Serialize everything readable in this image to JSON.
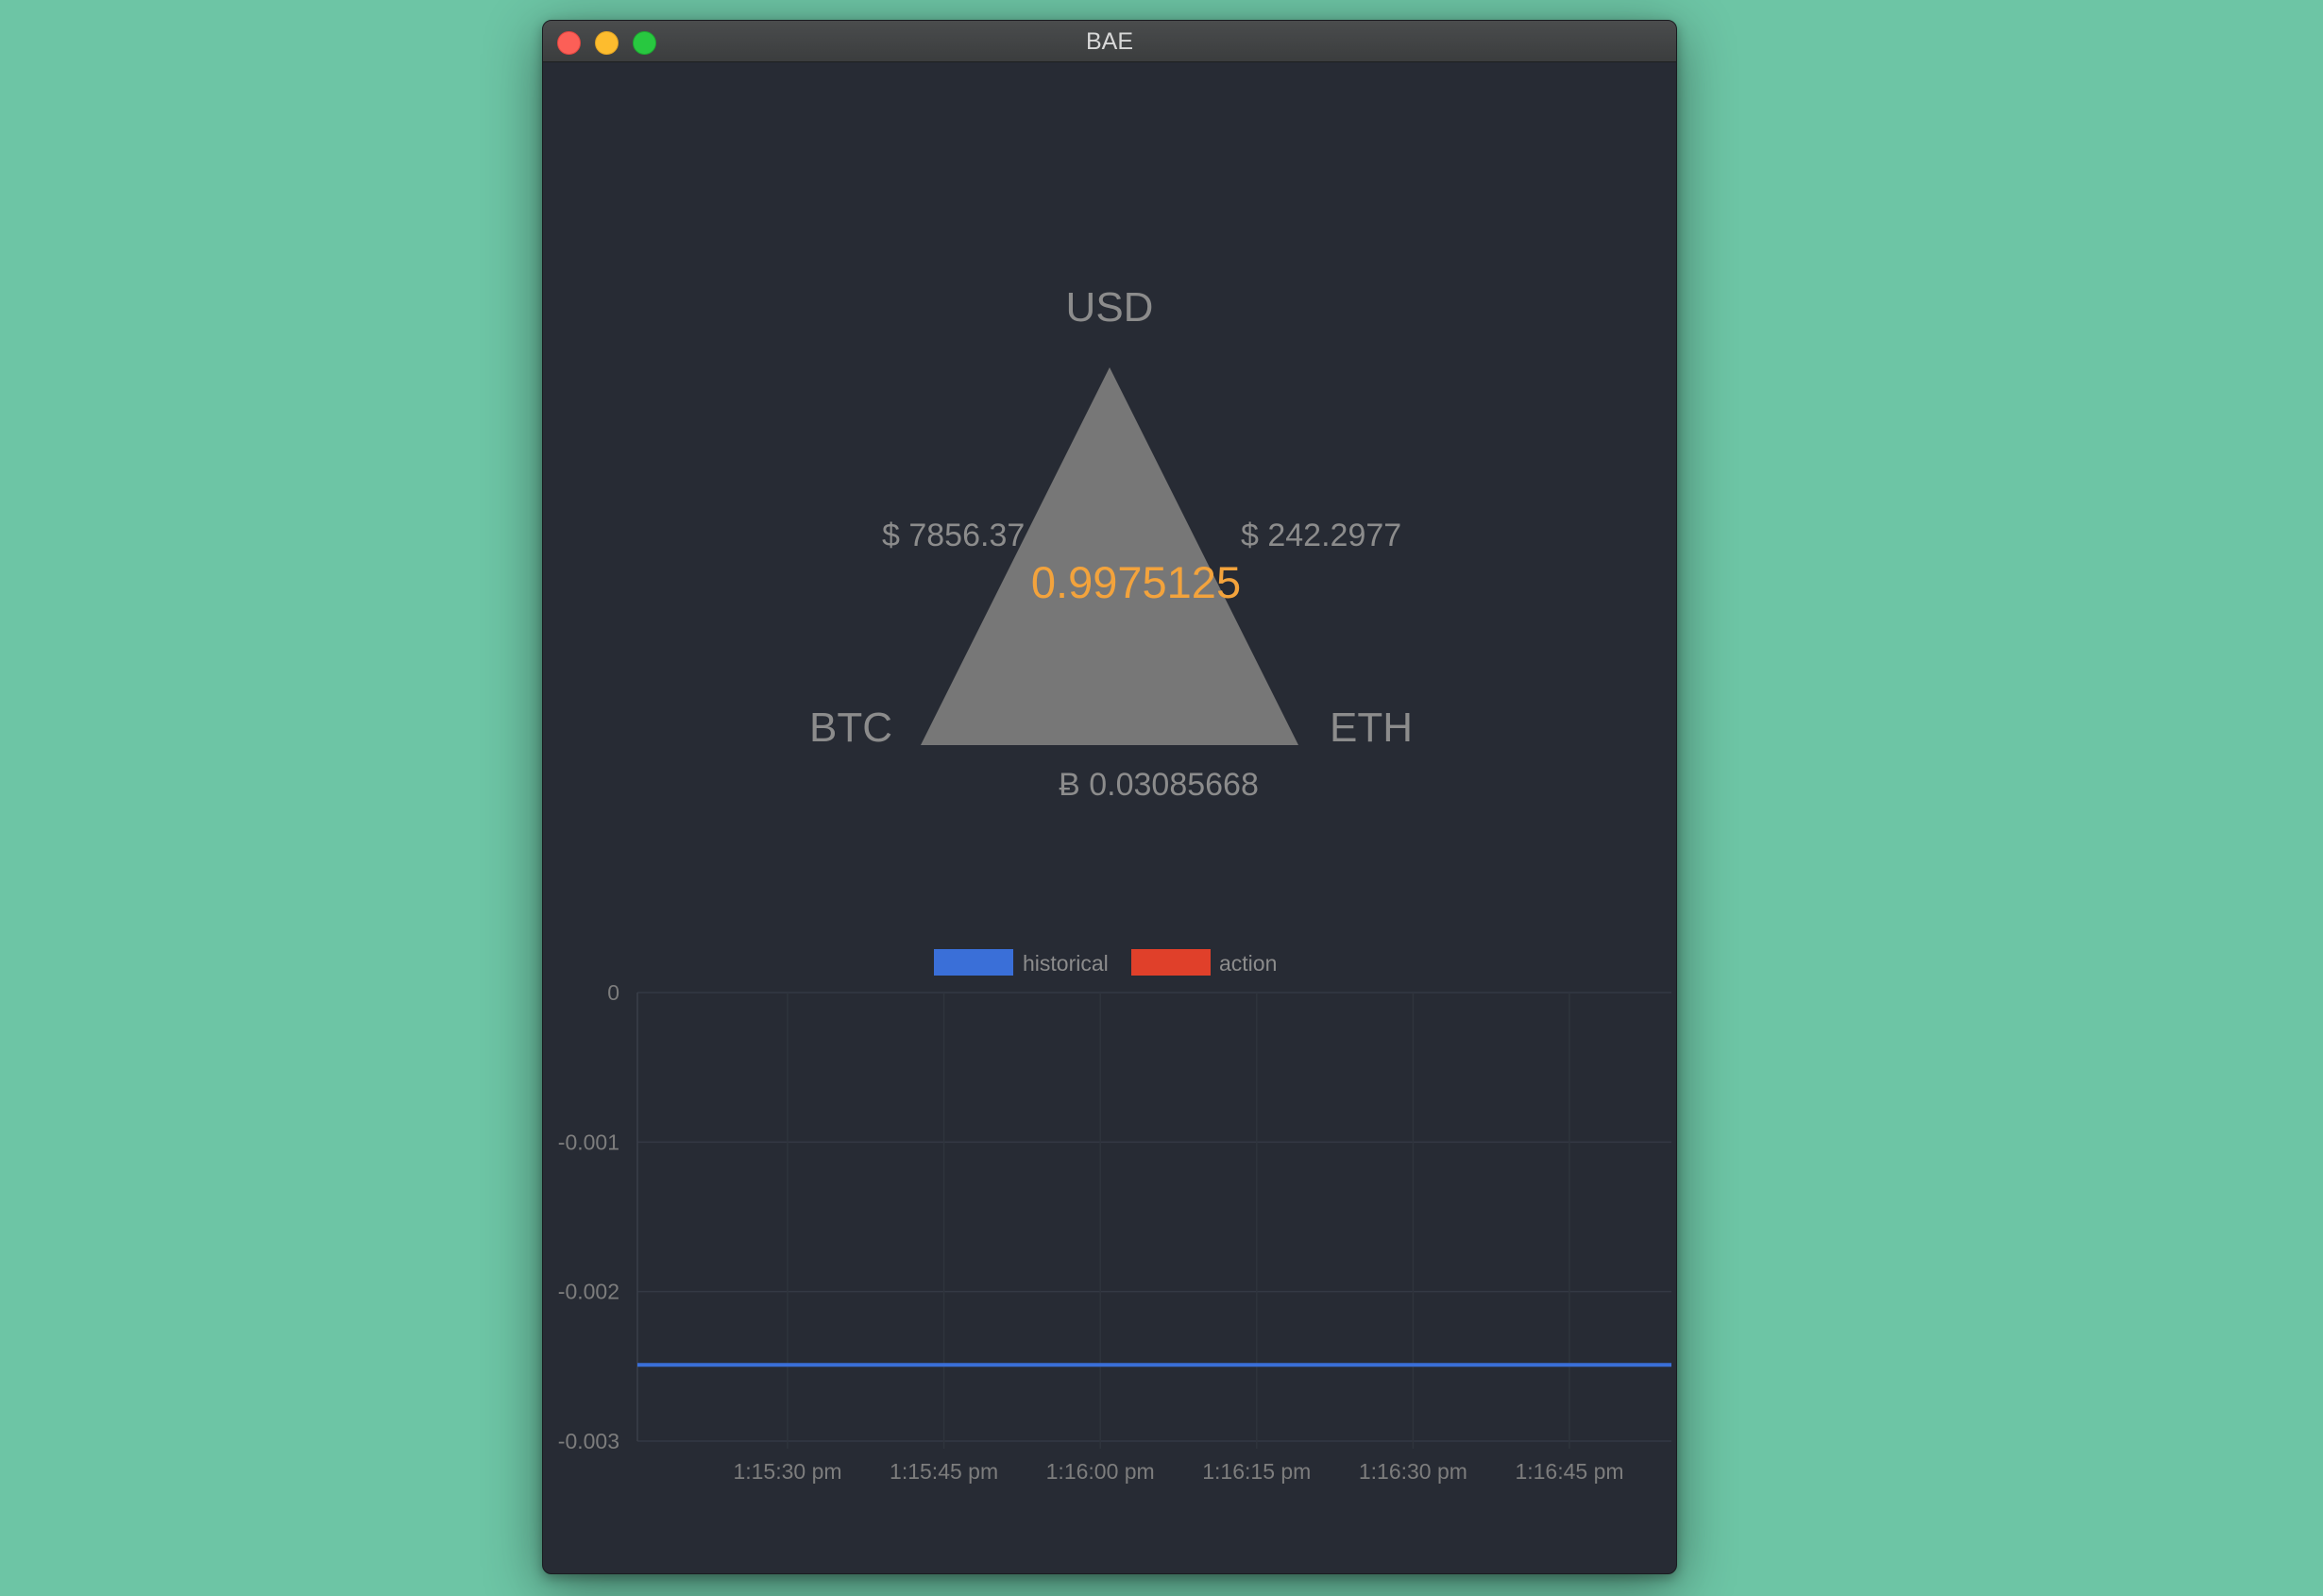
{
  "window": {
    "title": "BAE"
  },
  "triangle": {
    "top_label": "USD",
    "left_label": "BTC",
    "right_label": "ETH",
    "left_edge_value": "$ 7856.37",
    "right_edge_value": "$ 242.2977",
    "bottom_edge_value": "Ƀ 0.03085668",
    "center_value": "0.9975125",
    "center_color": "#f3a33c",
    "fill_color": "#777777"
  },
  "chart_data": {
    "type": "line",
    "legend": [
      {
        "name": "historical",
        "color": "#3a6fd8"
      },
      {
        "name": "action",
        "color": "#e0402a"
      }
    ],
    "legend_position": "top-center",
    "ylim": [
      -0.003,
      0
    ],
    "yticks": [
      "0",
      "-0.001",
      "-0.002",
      "-0.003"
    ],
    "xticks": [
      "1:15:30 pm",
      "1:15:45 pm",
      "1:16:00 pm",
      "1:16:15 pm",
      "1:16:30 pm",
      "1:16:45 pm"
    ],
    "grid": true,
    "series": [
      {
        "name": "historical",
        "color": "#3a6fd8",
        "values": [
          -0.00249,
          -0.00249,
          -0.00249,
          -0.00249,
          -0.00249,
          -0.00249,
          -0.00249,
          -0.00249,
          -0.00249,
          -0.00249,
          -0.00249
        ]
      }
    ]
  }
}
